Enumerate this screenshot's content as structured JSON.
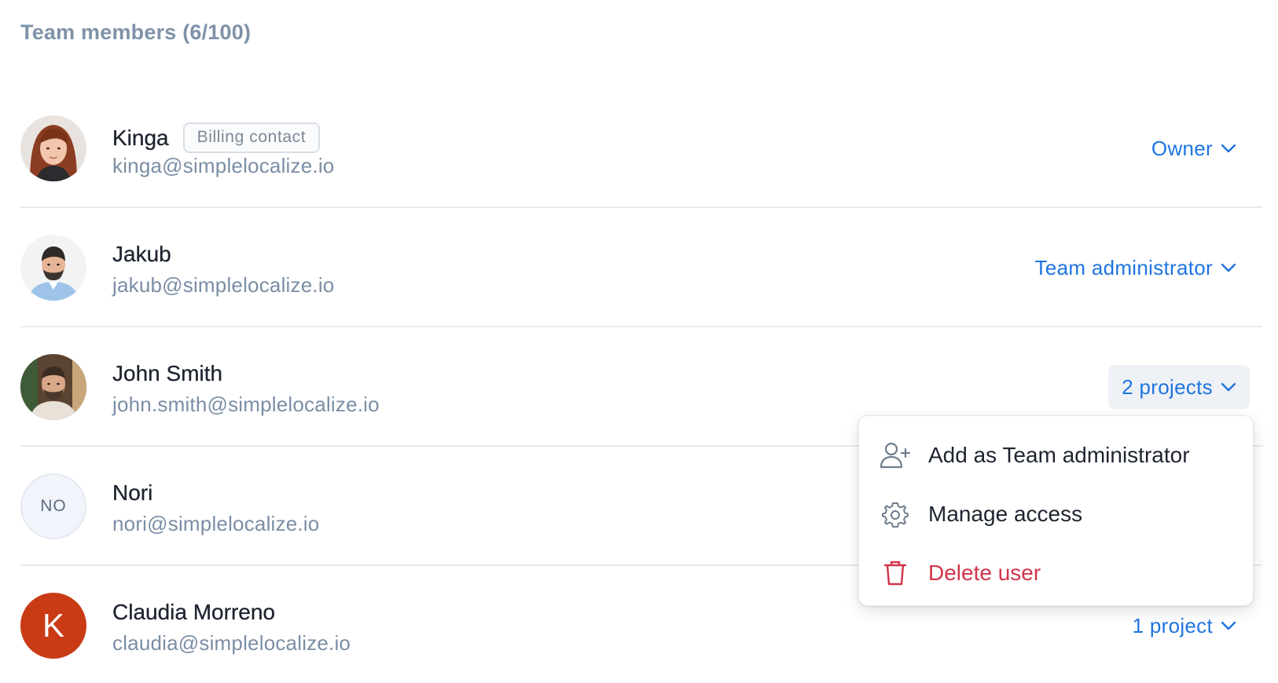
{
  "section": {
    "title": "Team members (6/100)"
  },
  "members": [
    {
      "name": "Kinga",
      "badge": "Billing contact",
      "email": "kinga@simplelocalize.io",
      "role": "Owner"
    },
    {
      "name": "Jakub",
      "email": "jakub@simplelocalize.io",
      "role": "Team administrator"
    },
    {
      "name": "John Smith",
      "email": "john.smith@simplelocalize.io",
      "role": "2 projects"
    },
    {
      "name": "Nori",
      "initials": "NO",
      "email": "nori@simplelocalize.io"
    },
    {
      "name": "Claudia Morreno",
      "letter": "K",
      "email": "claudia@simplelocalize.io",
      "role": "1 project"
    }
  ],
  "menu": {
    "items": [
      {
        "label": "Add as Team administrator",
        "icon": "user-plus-icon"
      },
      {
        "label": "Manage access",
        "icon": "gear-icon"
      },
      {
        "label": "Delete user",
        "icon": "trash-icon"
      }
    ]
  },
  "colors": {
    "accent": "#1f74e0",
    "danger": "#d1344a",
    "muted": "#7b8ea5",
    "avatar_k": "#c83b14"
  }
}
